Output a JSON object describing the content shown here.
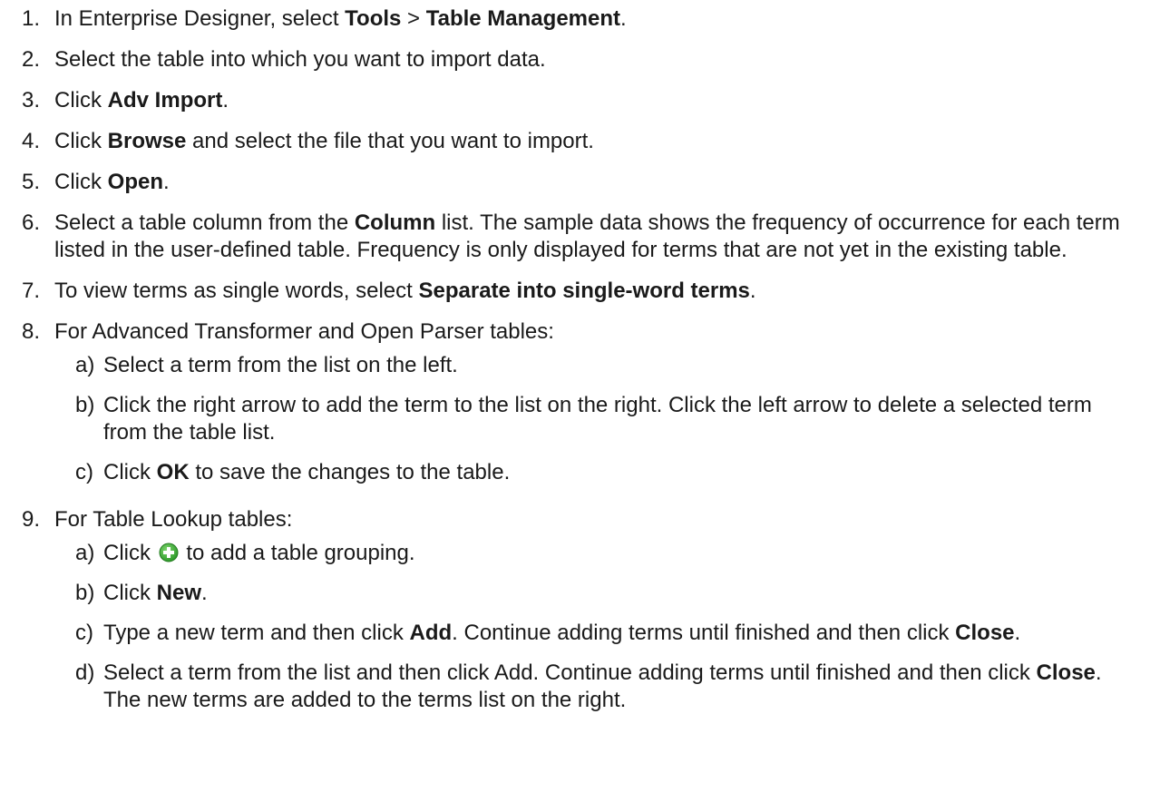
{
  "steps": [
    {
      "num": "1.",
      "parts": [
        "In Enterprise Designer, select ",
        "Tools",
        " > ",
        "Table Management",
        "."
      ]
    },
    {
      "num": "2.",
      "text": "Select the table into which you want to import data."
    },
    {
      "num": "3.",
      "parts": [
        "Click ",
        "Adv Import",
        "."
      ]
    },
    {
      "num": "4.",
      "parts": [
        "Click ",
        "Browse",
        " and select the file that you want to import."
      ]
    },
    {
      "num": "5.",
      "parts": [
        "Click ",
        "Open",
        "."
      ]
    },
    {
      "num": "6.",
      "parts": [
        "Select a table column from the ",
        "Column",
        " list. The sample data shows the frequency of occurrence for each term listed in the user-defined table. Frequency is only displayed for terms that are not yet in the existing table."
      ]
    },
    {
      "num": "7.",
      "parts": [
        "To view terms as single words, select ",
        "Separate into single-word terms",
        "."
      ]
    },
    {
      "num": "8.",
      "text": "For Advanced Transformer and Open Parser tables:",
      "sub": [
        {
          "let": "a)",
          "text": "Select a term from the list on the left."
        },
        {
          "let": "b)",
          "text": "Click the right arrow to add the term to the list on the right. Click the left arrow to delete a selected term from the table list."
        },
        {
          "let": "c)",
          "parts": [
            "Click ",
            "OK",
            " to save the changes to the table."
          ]
        }
      ]
    },
    {
      "num": "9.",
      "text": "For Table Lookup tables:",
      "sub": [
        {
          "let": "a)",
          "parts": [
            "Click ",
            " to add a table grouping."
          ],
          "icon": "add-circle-icon"
        },
        {
          "let": "b)",
          "parts": [
            "Click ",
            "New",
            "."
          ]
        },
        {
          "let": "c)",
          "parts": [
            "Type a new term and then click ",
            "Add",
            ". Continue adding terms until finished and then click ",
            "Close",
            "."
          ]
        },
        {
          "let": "d)",
          "parts": [
            "Select a term from the list and then click Add. Continue adding terms until finished and then click ",
            "Close",
            ". The new terms are added to the terms list on the right."
          ]
        }
      ]
    }
  ],
  "colors": {
    "text": "#1a1a1a",
    "icon_green": "#3aaa35",
    "icon_plus": "#ffffff"
  }
}
